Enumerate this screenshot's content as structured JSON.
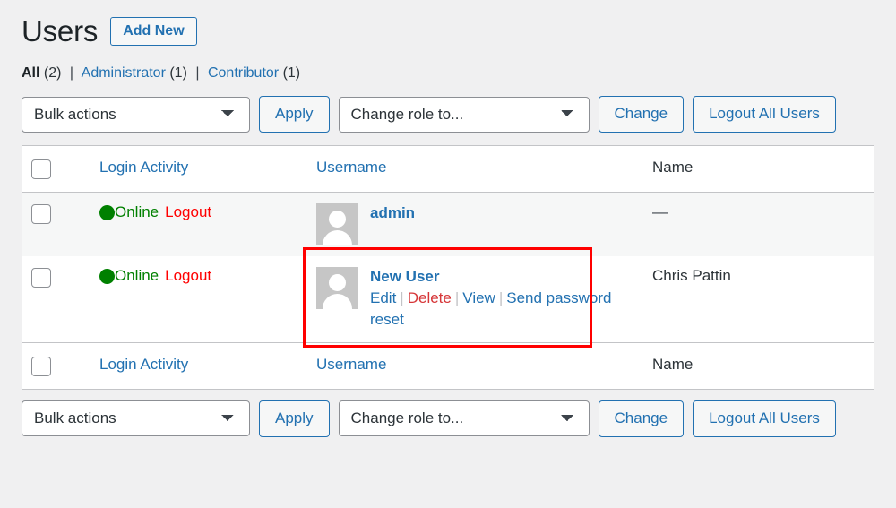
{
  "header": {
    "title": "Users",
    "add_new_label": "Add New"
  },
  "filters": {
    "all_label": "All",
    "all_count": "(2)",
    "administrator_label": "Administrator",
    "administrator_count": "(1)",
    "contributor_label": "Contributor",
    "contributor_count": "(1)",
    "separator": "|"
  },
  "toolbar_top": {
    "bulk_actions_value": "Bulk actions",
    "apply_label": "Apply",
    "change_role_value": "Change role to...",
    "change_label": "Change",
    "logout_all_label": "Logout All Users"
  },
  "toolbar_bottom": {
    "bulk_actions_value": "Bulk actions",
    "apply_label": "Apply",
    "change_role_value": "Change role to...",
    "change_label": "Change",
    "logout_all_label": "Logout All Users"
  },
  "table": {
    "columns": {
      "login_activity": "Login Activity",
      "username": "Username",
      "name": "Name"
    },
    "rows": [
      {
        "status_text": "Online",
        "logout_label": "Logout",
        "username": "admin",
        "name": "—",
        "actions": []
      },
      {
        "status_text": "Online",
        "logout_label": "Logout",
        "username": "New User",
        "name": "Chris Pattin",
        "actions": [
          {
            "label": "Edit",
            "style": "link"
          },
          {
            "label": "Delete",
            "style": "delete"
          },
          {
            "label": "View",
            "style": "link"
          },
          {
            "label": "Send password reset",
            "style": "link"
          }
        ],
        "action_separator": "|",
        "highlighted": true
      }
    ]
  },
  "colors": {
    "link": "#2271b1",
    "online": "#008000",
    "logout": "#ff0000",
    "delete": "#d63638",
    "highlight_border": "#ff0000",
    "page_background": "#f0f0f1"
  }
}
